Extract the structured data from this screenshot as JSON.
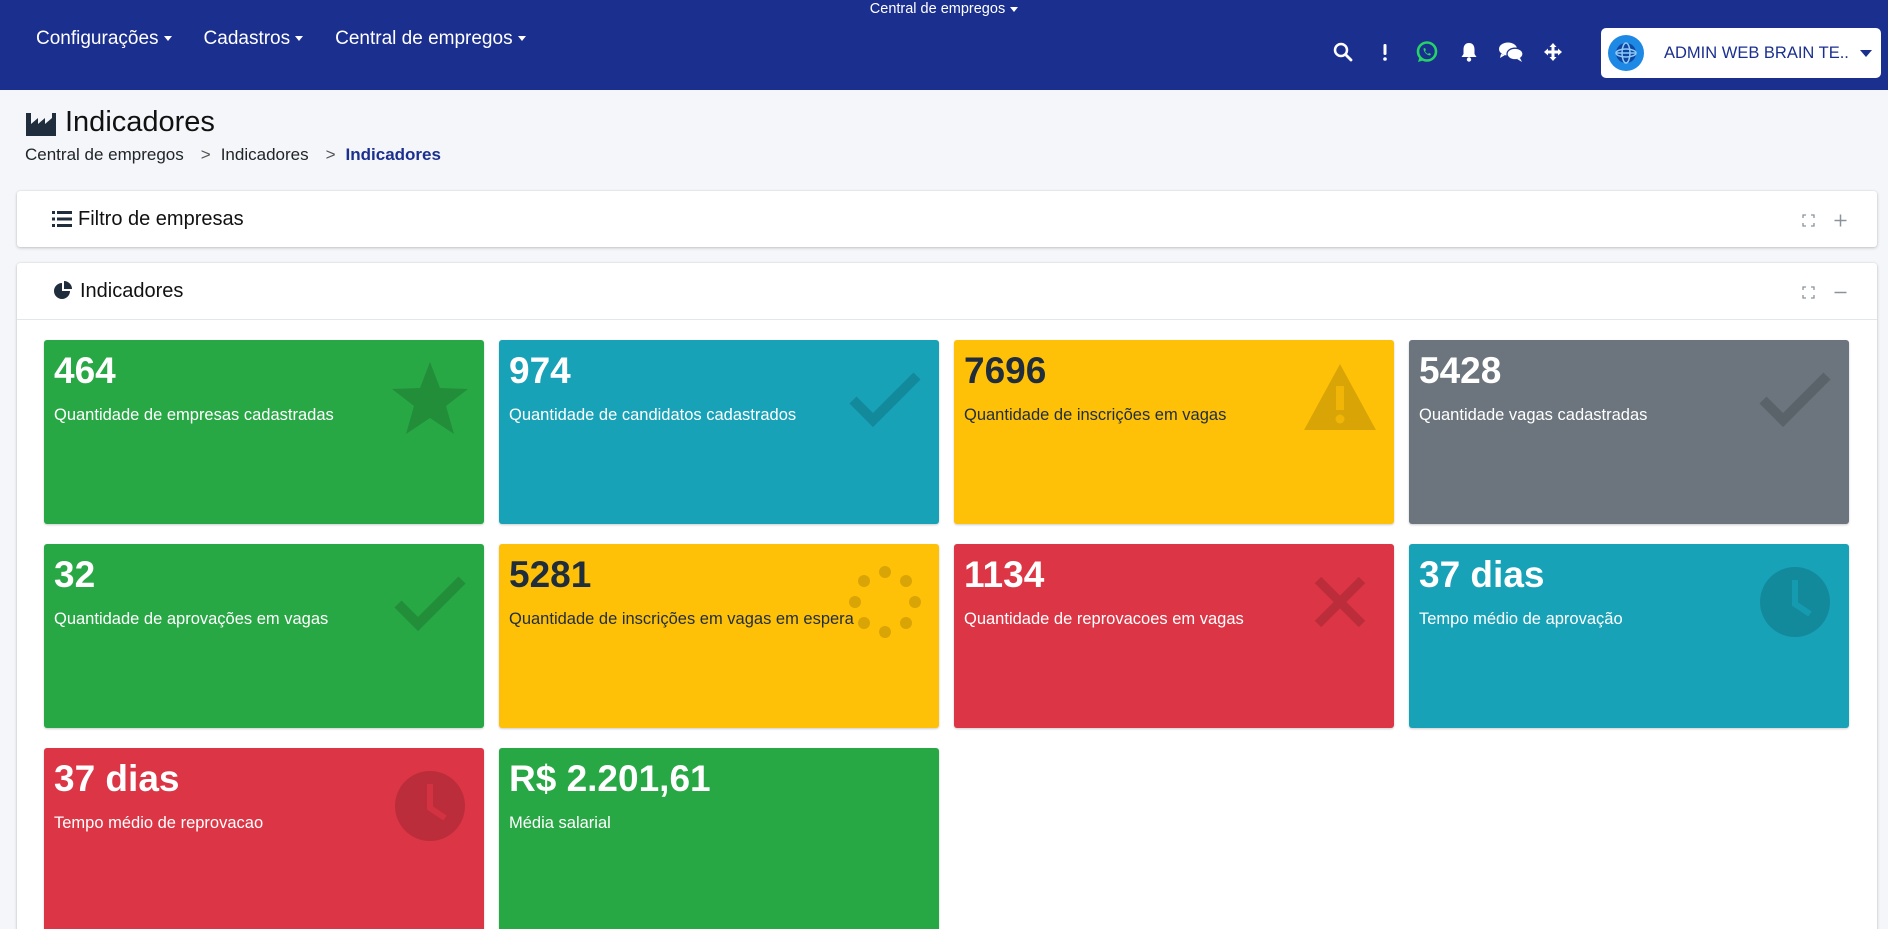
{
  "navbar": {
    "top_center": "Central de empregos",
    "menu": [
      "Configurações",
      "Cadastros",
      "Central de empregos"
    ],
    "icons": [
      "search-icon",
      "exclamation-icon",
      "whatsapp-icon",
      "bell-icon",
      "chat-icon",
      "arrows-move-icon"
    ],
    "user_name": "ADMIN WEB BRAIN TE..."
  },
  "page": {
    "title": "Indicadores",
    "breadcrumb": [
      "Central de empregos",
      "Indicadores",
      "Indicadores"
    ],
    "breadcrumb_sep": ">"
  },
  "filter_card": {
    "title": "Filtro de empresas"
  },
  "indicators_card": {
    "title": "Indicadores",
    "boxes": [
      {
        "value": "464",
        "label": "Quantidade de empresas cadastradas",
        "color": "#28a745",
        "icon": "star-icon"
      },
      {
        "value": "974",
        "label": "Quantidade de candidatos cadastrados",
        "color": "#17a2b8",
        "icon": "check-icon"
      },
      {
        "value": "7696",
        "label": "Quantidade de inscrições em vagas",
        "color": "#ffc107",
        "icon": "warning-icon"
      },
      {
        "value": "5428",
        "label": "Quantidade vagas cadastradas",
        "color": "#6c757d",
        "icon": "check-icon"
      },
      {
        "value": "32",
        "label": "Quantidade de aprovações em vagas",
        "color": "#28a745",
        "icon": "check-icon"
      },
      {
        "value": "5281",
        "label": "Quantidade de inscrições em vagas em espera",
        "color": "#ffc107",
        "icon": "spinner-icon"
      },
      {
        "value": "1134",
        "label": "Quantidade de reprovacoes em vagas",
        "color": "#dc3545",
        "icon": "close-icon"
      },
      {
        "value": "37 dias",
        "label": "Tempo médio de aprovação",
        "color": "#17a2b8",
        "icon": "clock-icon"
      },
      {
        "value": "37 dias",
        "label": "Tempo médio de reprovacao",
        "color": "#dc3545",
        "icon": "clock-icon"
      },
      {
        "value": "R$ 2.201,61",
        "label": "Média salarial",
        "color": "#28a745",
        "icon": ""
      }
    ]
  }
}
